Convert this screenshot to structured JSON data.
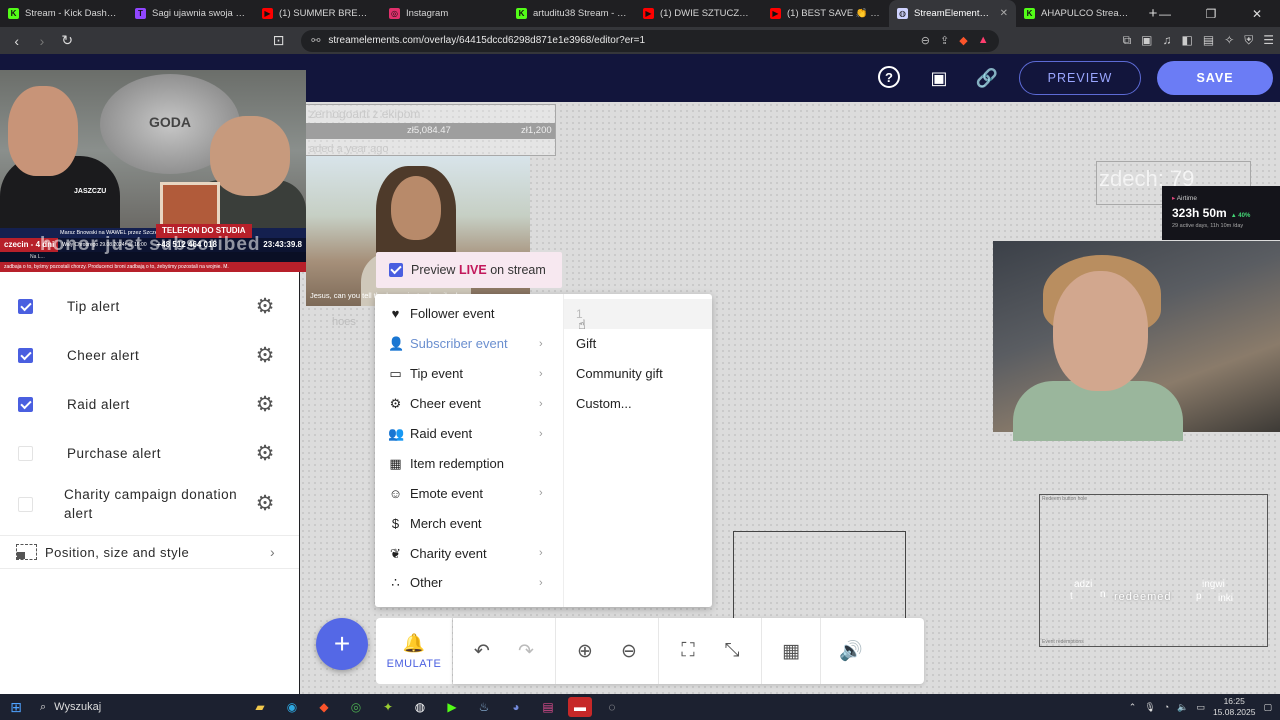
{
  "browser": {
    "tabs": [
      {
        "title": "Stream - Kick Dashboard",
        "color": "#53fc18",
        "glyph": "K"
      },
      {
        "title": "Sagi ujawnia swoja fałszyw",
        "color": "#9146ff",
        "glyph": "T"
      },
      {
        "title": "(1) SUMMER BREEZE | LIVE",
        "color": "#ff0000",
        "glyph": "▶"
      },
      {
        "title": "Instagram",
        "color": "#e1306c",
        "glyph": "◎"
      },
      {
        "title": "artuditu38 Stream - Watch",
        "color": "#53fc18",
        "glyph": "K"
      },
      {
        "title": "(1) DWIE SZTUCZKI - YouT",
        "color": "#ff0000",
        "glyph": "▶"
      },
      {
        "title": "(1) BEST SAVE 👏 #league",
        "color": "#ff0000",
        "glyph": "▶"
      },
      {
        "title": "StreamElements - C",
        "color": "#cfd3ff",
        "glyph": "◍",
        "active": true
      },
      {
        "title": "AHAPULCO Stream - Watc",
        "color": "#53fc18",
        "glyph": "K"
      }
    ],
    "url": "streamelements.com/overlay/64415dccd6298d871e1e3968/editor?er=1"
  },
  "header": {
    "help_icon": "help-circle-icon",
    "preview_label": "PREVIEW",
    "save_label": "SAVE"
  },
  "canvas": {
    "goal_text": "zernogoarti z ekipom",
    "goal_amount_1": "zł5,084.47",
    "goal_amount_2": "zł1,200",
    "goal_sub": "aded a year ago",
    "counter_text": "zdech: 79",
    "jesus_caption": "Jesus, can you tell the honor just subscribed",
    "airtime_label": "Airtime",
    "airtime_value": "323h 50m",
    "airtime_pct": "▲ 40%",
    "airtime_small": "29 active days, 11h 10m /day",
    "redeemed_text": "redeemed",
    "redeemed_caption": "Redeem button hole",
    "redeemed_foot": "Event redemptions",
    "ghost_1": "adzi",
    "ghost_2": "ingwi",
    "ghost_3": "inki",
    "ghost_4": "t",
    "ghost_5": "n",
    "ghost_6": "p",
    "ghost_7": "hoes"
  },
  "webcam": {
    "emblem_text": "GODA",
    "shirt_text": "JASZCZU",
    "ticker_top": "Marsz Bnowski na WAWEL przez Szczecin",
    "ticker_day": "czecin - 4 dni",
    "ticker_note": "Wały Chrobrego 29.08.2024r @ 16:00",
    "ticker_tel_label": "TELEFON DO STUDIA",
    "ticker_phone": "+48 512 464 018",
    "ticker_clock": "23:43:39.8",
    "ticker_scroll": "Na L...",
    "ticker_bottom": "zadbaja o to, byśmy pozostali chorzy. Producenci broni zadbają o to, żebyśmy pozostali na wojnie. M.",
    "overlay_text": "honor just subscribed"
  },
  "alerts": [
    {
      "label": "Tip alert",
      "checked": true
    },
    {
      "label": "Cheer alert",
      "checked": true
    },
    {
      "label": "Raid alert",
      "checked": true
    },
    {
      "label": "Purchase alert",
      "checked": false
    },
    {
      "label": "Charity campaign donation alert",
      "checked": false
    }
  ],
  "position_row": {
    "label": "Position, size and style"
  },
  "preview_live": {
    "prefix": "Preview ",
    "live": "LIVE",
    "suffix": " on stream"
  },
  "menu": {
    "items": [
      {
        "label": "Follower event",
        "icon": "heart-icon",
        "glyph": "♥",
        "submenu": false
      },
      {
        "label": "Subscriber event",
        "icon": "person-icon",
        "glyph": "👤",
        "submenu": true,
        "highlighted": true
      },
      {
        "label": "Tip event",
        "icon": "card-icon",
        "glyph": "▭",
        "submenu": true
      },
      {
        "label": "Cheer event",
        "icon": "cheer-icon",
        "glyph": "⚙",
        "submenu": true
      },
      {
        "label": "Raid event",
        "icon": "group-icon",
        "glyph": "👥",
        "submenu": true
      },
      {
        "label": "Item redemption",
        "icon": "gift-box-icon",
        "glyph": "▦",
        "submenu": false
      },
      {
        "label": "Emote event",
        "icon": "smiley-icon",
        "glyph": "☺",
        "submenu": true
      },
      {
        "label": "Merch event",
        "icon": "dollar-icon",
        "glyph": "$",
        "submenu": false
      },
      {
        "label": "Charity event",
        "icon": "hand-heart-icon",
        "glyph": "❦",
        "submenu": true
      },
      {
        "label": "Other",
        "icon": "dots-icon",
        "glyph": "∴",
        "submenu": true
      }
    ],
    "subitems": [
      {
        "label": "1"
      },
      {
        "label": "Gift"
      },
      {
        "label": "Community gift"
      },
      {
        "label": "Custom..."
      }
    ]
  },
  "bottom": {
    "emulate_label": "EMULATE",
    "fab_icon": "plus-icon"
  },
  "taskbar": {
    "search_placeholder": "Wyszukaj",
    "time": "16:25",
    "date": "15.08.2025"
  },
  "colors": {
    "accent": "#5468e6",
    "header": "#12153c",
    "live": "#c2185b"
  }
}
